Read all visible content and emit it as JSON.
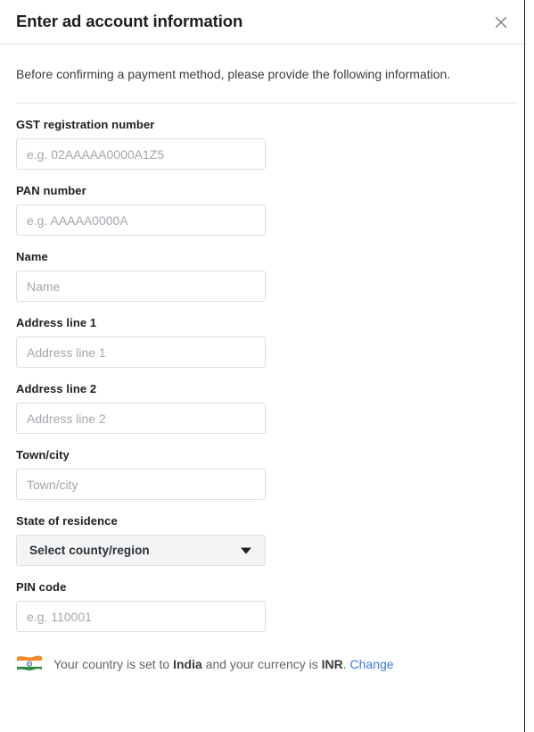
{
  "dialog": {
    "title": "Enter ad account information",
    "close_icon": "close-icon",
    "intro": "Before confirming a payment method, please provide the following information."
  },
  "form": {
    "fields": [
      {
        "label": "GST registration number",
        "placeholder": "e.g. 02AAAAA0000A1Z5",
        "value": "",
        "type": "text"
      },
      {
        "label": "PAN number",
        "placeholder": "e.g. AAAAA0000A",
        "value": "",
        "type": "text"
      },
      {
        "label": "Name",
        "placeholder": "Name",
        "value": "",
        "type": "text"
      },
      {
        "label": "Address line 1",
        "placeholder": "Address line 1",
        "value": "",
        "type": "text"
      },
      {
        "label": "Address line 2",
        "placeholder": "Address line 2",
        "value": "",
        "type": "text"
      },
      {
        "label": "Town/city",
        "placeholder": "Town/city",
        "value": "",
        "type": "text"
      },
      {
        "label": "State of residence",
        "selected": "Select county/region",
        "type": "select"
      },
      {
        "label": "PIN code",
        "placeholder": "e.g. 110001",
        "value": "",
        "type": "text"
      }
    ]
  },
  "footer": {
    "flag_icon": "india-flag-icon",
    "text_before_country": "Your country is set to ",
    "country": "India",
    "text_middle": " and your currency is ",
    "currency": "INR",
    "text_after": ". ",
    "change_label": "Change"
  },
  "colors": {
    "link": "#3b78e7",
    "text_primary": "#1c1e21",
    "text_secondary": "#606468",
    "placeholder": "#a2a7ad",
    "border": "#dcdee1",
    "divider": "#e4e6e9",
    "select_bg": "#f4f5f6"
  }
}
